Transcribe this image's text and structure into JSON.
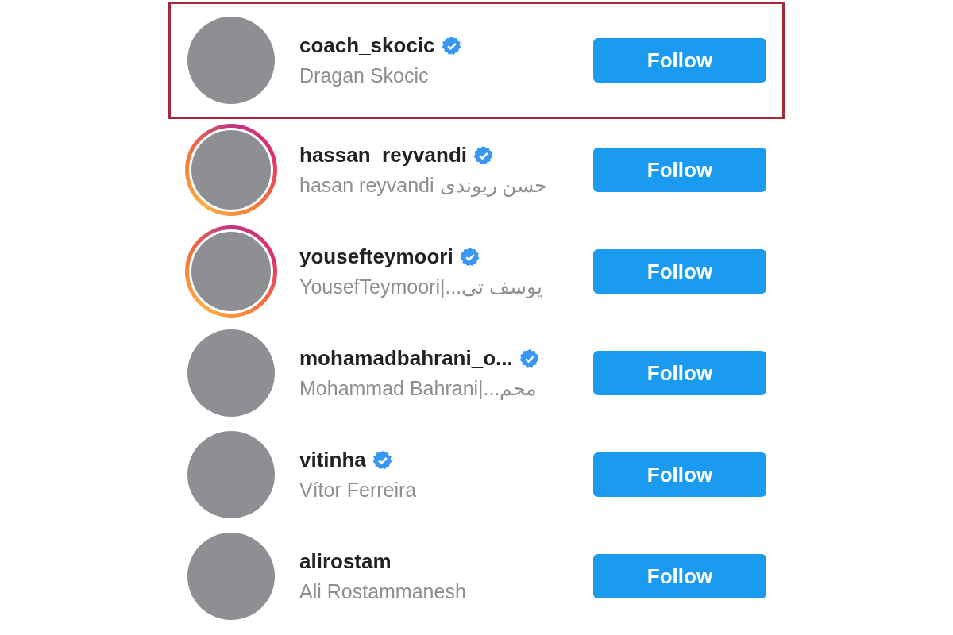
{
  "users": [
    {
      "username": "coach_skocic",
      "verified": true,
      "name": "Dragan Skocic",
      "story_ring": false,
      "highlighted": true,
      "button": "Follow"
    },
    {
      "username": "hassan_reyvandi",
      "verified": true,
      "name": "hasan reyvandi حسن ریوندی",
      "story_ring": true,
      "highlighted": false,
      "button": "Follow"
    },
    {
      "username": "yousefteymoori",
      "verified": true,
      "name": "YousefTeymoori|...یوسف تی",
      "story_ring": true,
      "highlighted": false,
      "button": "Follow"
    },
    {
      "username": "mohamadbahrani_o...",
      "verified": true,
      "name": "Mohammad Bahrani|...محم",
      "story_ring": false,
      "highlighted": false,
      "button": "Follow"
    },
    {
      "username": "vitinha",
      "verified": true,
      "name": "Vítor Ferreira",
      "story_ring": false,
      "highlighted": false,
      "button": "Follow"
    },
    {
      "username": "alirostam",
      "verified": false,
      "name": "Ali Rostammanesh",
      "story_ring": false,
      "highlighted": false,
      "button": "Follow"
    }
  ]
}
